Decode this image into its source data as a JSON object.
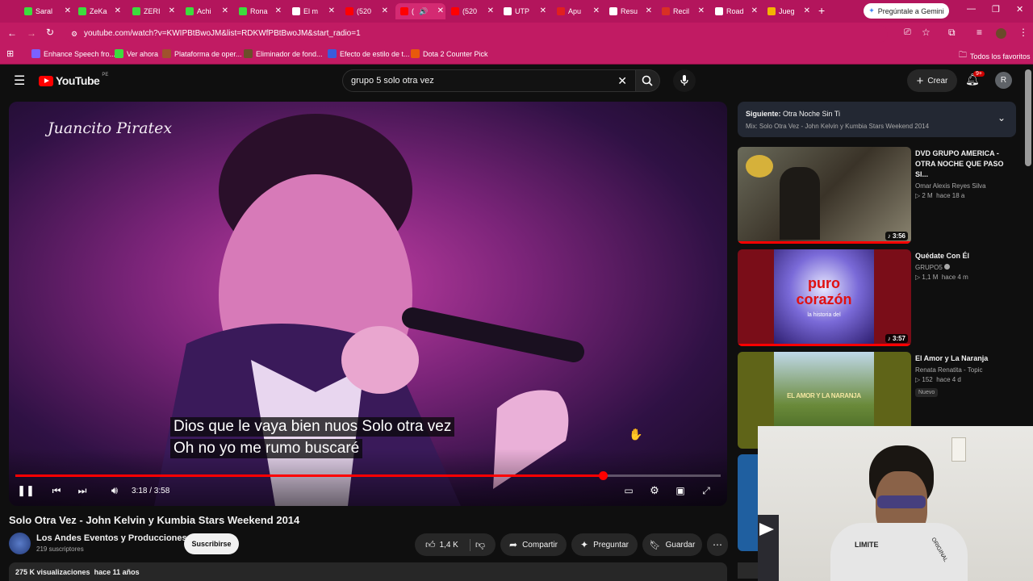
{
  "browser": {
    "tabs": [
      {
        "label": "Saral",
        "color": "#3ddc3d"
      },
      {
        "label": "ZeKa",
        "color": "#3ddc3d"
      },
      {
        "label": "ZERI",
        "color": "#3ddc3d"
      },
      {
        "label": "Achi",
        "color": "#3ddc3d"
      },
      {
        "label": "Rona",
        "color": "#3ddc3d"
      },
      {
        "label": "El m",
        "color": "#ffffff"
      },
      {
        "label": "(520",
        "color": "#ff0000"
      },
      {
        "label": "(",
        "color": "#ff0000"
      },
      {
        "label": "(520",
        "color": "#ff0000"
      },
      {
        "label": "UTP",
        "color": "#ffffff"
      },
      {
        "label": "Apu",
        "color": "#e02020"
      },
      {
        "label": "Resu",
        "color": "#ffffff"
      },
      {
        "label": "Recil",
        "color": "#d93025"
      },
      {
        "label": "Road",
        "color": "#ffffff"
      },
      {
        "label": "Jueg",
        "color": "#f4b400"
      }
    ],
    "new_tab": "+",
    "gemini_button": "Pregúntale a Gemini",
    "url": "youtube.com/watch?v=KWIPBtBwoJM&list=RDKWfPBtBwoJM&start_radio=1",
    "bookmarks": [
      {
        "label": "Enhance Speech fro...",
        "color": "#7b61ff"
      },
      {
        "label": "Ver ahora",
        "color": "#3ddc3d"
      },
      {
        "label": "Plataforma de oper...",
        "color": "#a0522d"
      },
      {
        "label": "Eliminador de fond...",
        "color": "#6b4f2a"
      },
      {
        "label": "Efecto de estilo de t...",
        "color": "#3b5bdb"
      },
      {
        "label": "Dota 2 Counter Pick",
        "color": "#e8590c"
      }
    ],
    "all_bookmarks": "Todos los favoritos"
  },
  "youtube": {
    "logo_text": "YouTube",
    "logo_region": "PE",
    "search_query": "grupo 5 solo otra vez",
    "create_label": "Crear",
    "notif_badge": "9+",
    "avatar_letter": "R"
  },
  "player": {
    "watermark": "Juancito Piratex",
    "caption_line1": "Dios que le vaya bien nuos Solo otra vez",
    "caption_line2": "Oh no yo me rumo buscaré",
    "time": "3:18 / 3:58",
    "progress": 0.833
  },
  "video": {
    "title": "Solo Otra Vez - John Kelvin y Kumbia Stars Weekend 2014",
    "channel": "Los Andes Eventos y Producciones",
    "subscribers": "219 suscriptores",
    "subscribe_label": "Suscribirse",
    "likes": "1,4 K",
    "share_label": "Compartir",
    "ask_label": "Preguntar",
    "save_label": "Guardar",
    "views": "275 K visualizaciones",
    "age": "hace 11 años"
  },
  "next": {
    "label": "Siguiente:",
    "title": "Otra Noche Sin Ti",
    "mix": "Mix: Solo Otra Vez - John Kelvin y Kumbia Stars Weekend 2014"
  },
  "recommendations": [
    {
      "title": "DVD GRUPO AMERICA - OTRA NOCHE QUE PASO SI...",
      "channel": "Omar Alexis Reyes Silva",
      "views": "2 M",
      "age": "hace 18 a",
      "duration": "3:56"
    },
    {
      "title": "Quédate Con Él",
      "channel": "GRUPO5",
      "views": "1,1 M",
      "age": "hace 4 m",
      "duration": "3:57",
      "thumb_text1": "puro",
      "thumb_text2": "corazón",
      "thumb_text3": "la historia del"
    },
    {
      "title": "El Amor y La Naranja",
      "channel": "Renata Renatita - Topic",
      "views": "152",
      "age": "hace 4 d",
      "badge": "Nuevo",
      "thumb_text": "EL AMOR Y LA NARANJA"
    }
  ],
  "webcam": {
    "shirt_text": "LIMITE",
    "sleeve_text": "ORIGINAL"
  }
}
